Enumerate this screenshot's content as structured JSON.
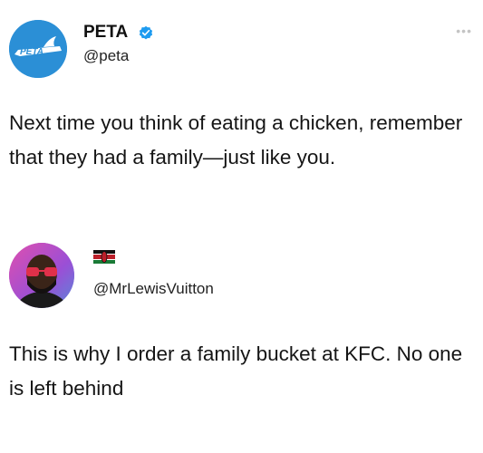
{
  "tweet": {
    "display_name": "PETA",
    "handle": "@peta",
    "text": "Next time you think of eating a chicken, remember that they had a family—just like you.",
    "avatar_text": "PETA",
    "more_icon": "more-horizontal-icon"
  },
  "reply": {
    "handle": "@MrLewisVuitton",
    "text": "This is why I order a family bucket at KFC. No one is left behind",
    "flag_icon": "kenya-flag-icon"
  },
  "colors": {
    "verified_badge": "#1d9bf0",
    "peta_avatar_bg": "#2b8fd6"
  }
}
